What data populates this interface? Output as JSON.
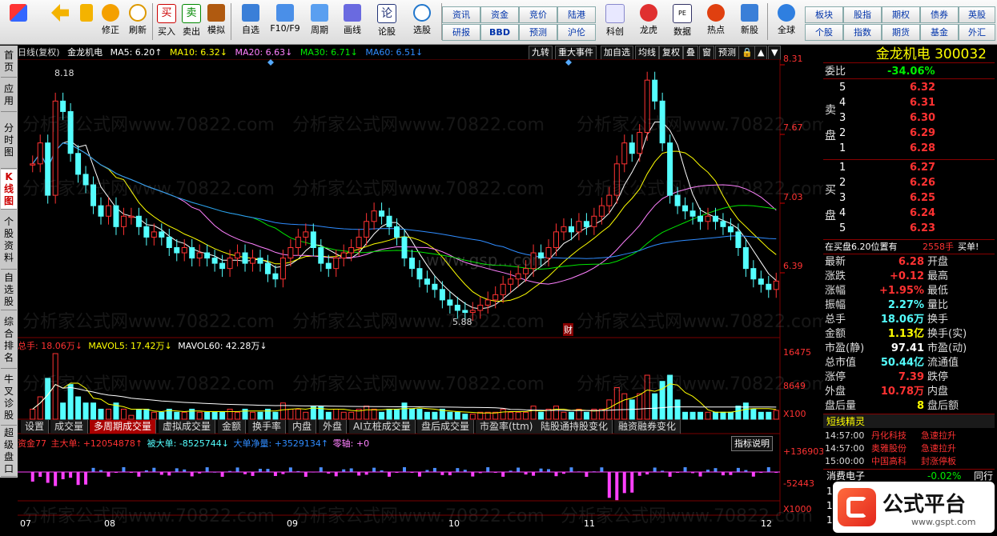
{
  "toolbar": {
    "buttons": [
      "修正",
      "刷新",
      "买入",
      "卖出",
      "模拟",
      "自选",
      "F10/F9",
      "周期",
      "画线",
      "论股",
      "选股",
      "科创",
      "龙虎",
      "数据",
      "热点",
      "新股",
      "全球"
    ],
    "grid_buttons": [
      "资讯",
      "资金",
      "竞价",
      "陆港",
      "研报",
      "BBD",
      "预测",
      "沪伦",
      "板块",
      "股指",
      "期权",
      "债券",
      "英股",
      "个股",
      "指数",
      "期货",
      "基金",
      "外汇"
    ]
  },
  "lefttabs": [
    "首页",
    "应用",
    "分时图",
    "K线图",
    "个股资料",
    "自选股",
    "综合排名",
    "牛叉诊股",
    "超级盘口"
  ],
  "chart_header": {
    "period": "日线(复权)",
    "name": "金龙机电",
    "ma5": "MA5: 6.20↑",
    "ma10": "MA10: 6.32↓",
    "ma20": "MA20: 6.63↓",
    "ma30": "MA30: 6.71↓",
    "ma60": "MA60: 6.51↓"
  },
  "chart_buttons": [
    "九转",
    "重大事件",
    "加自选",
    "均线",
    "复权",
    "叠",
    "窗",
    "预测"
  ],
  "watermark": "分析家公式网www.70822.com",
  "watermark2": "www.gsp...com",
  "price_axis": [
    "8.31",
    "7.67",
    "7.03",
    "6.39"
  ],
  "price_marks": {
    "high": "8.18",
    "low": "5.88",
    "cai": "财"
  },
  "vol_header": {
    "total": "总手: 18.06万↓",
    "mavol5": "MAVOL5: 17.42万↓",
    "mavol60": "MAVOL60: 42.28万↓"
  },
  "vol_axis": [
    "16475",
    "8649",
    "X100"
  ],
  "bottom_tabs": [
    "设置",
    "成交量",
    "多周期成交量",
    "虚拟成交量",
    "金额",
    "换手率",
    "内盘",
    "外盘",
    "AI立桩成交量",
    "盘后成交量",
    "市盈率(ttm)",
    "陆股通持股变化",
    "融资融券变化"
  ],
  "fund_header": {
    "name": "资金77",
    "main": "主大单: +12054878↑",
    "passive": "被大单: -8525744↓",
    "net": "大单净量: +3529134↑",
    "zero": "零轴: +0"
  },
  "fund_axis": [
    "+136903",
    "-52443",
    "X1000"
  ],
  "indicator_button": "指标说明",
  "date_axis": [
    "07",
    "08",
    "09",
    "10",
    "11",
    "12"
  ],
  "rp": {
    "title": "金龙机电 300032",
    "weibi_label": "委比",
    "weibi": "-34.06%",
    "sell_label": [
      "卖",
      "盘"
    ],
    "buy_label": [
      "买",
      "盘"
    ],
    "sell": [
      {
        "lvl": "5",
        "price": "6.32"
      },
      {
        "lvl": "4",
        "price": "6.31"
      },
      {
        "lvl": "3",
        "price": "6.30"
      },
      {
        "lvl": "2",
        "price": "6.29"
      },
      {
        "lvl": "1",
        "price": "6.28"
      }
    ],
    "buy": [
      {
        "lvl": "1",
        "price": "6.27"
      },
      {
        "lvl": "2",
        "price": "6.26"
      },
      {
        "lvl": "3",
        "price": "6.25"
      },
      {
        "lvl": "4",
        "price": "6.24"
      },
      {
        "lvl": "5",
        "price": "6.23"
      }
    ],
    "buy_note": "在买盘6.20位置有",
    "buy_note_qty": "2558手",
    "buy_note_end": "买单!",
    "stats": [
      {
        "l": "最新",
        "v": "6.28",
        "r": "开盘"
      },
      {
        "l": "涨跌",
        "v": "+0.12",
        "r": "最高"
      },
      {
        "l": "涨幅",
        "v": "+1.95%",
        "r": "最低"
      },
      {
        "l": "振幅",
        "v": "2.27%",
        "r": "量比"
      },
      {
        "l": "总手",
        "v": "18.06万",
        "r": "换手"
      },
      {
        "l": "金额",
        "v": "1.13亿",
        "r": "换手(实)"
      },
      {
        "l": "市盈(静)",
        "v": "97.41",
        "r": "市盈(动)"
      },
      {
        "l": "总市值",
        "v": "50.44亿",
        "r": "流通值"
      },
      {
        "l": "涨停",
        "v": "7.39",
        "r": "跌停"
      },
      {
        "l": "外盘",
        "v": "10.78万",
        "r": "内盘"
      },
      {
        "l": "盘后量",
        "v": "8",
        "r": "盘后额"
      }
    ],
    "news_title": "短线精灵",
    "news": [
      {
        "time": "14:57:00",
        "name": "丹化科技",
        "event": "急速拉升"
      },
      {
        "time": "14:57:00",
        "name": "奥雅股份",
        "event": "急速拉升"
      },
      {
        "time": "15:00:00",
        "name": "中国高科",
        "event": "封涨停板"
      }
    ],
    "sector": "消费电子",
    "sector_chg": "-0.02%",
    "sector_end": "同行",
    "rows": [
      "1",
      "1",
      "1"
    ],
    "brand": "公式平台",
    "brand_url": "www.gspt.com"
  },
  "colors": {
    "up": "#ff3232",
    "down": "#54ffff",
    "ma5": "#ffffff",
    "ma10": "#ffff00",
    "ma20": "#ff80ff",
    "ma30": "#00e600",
    "ma60": "#2f8cff",
    "grid": "#7a0000"
  }
}
